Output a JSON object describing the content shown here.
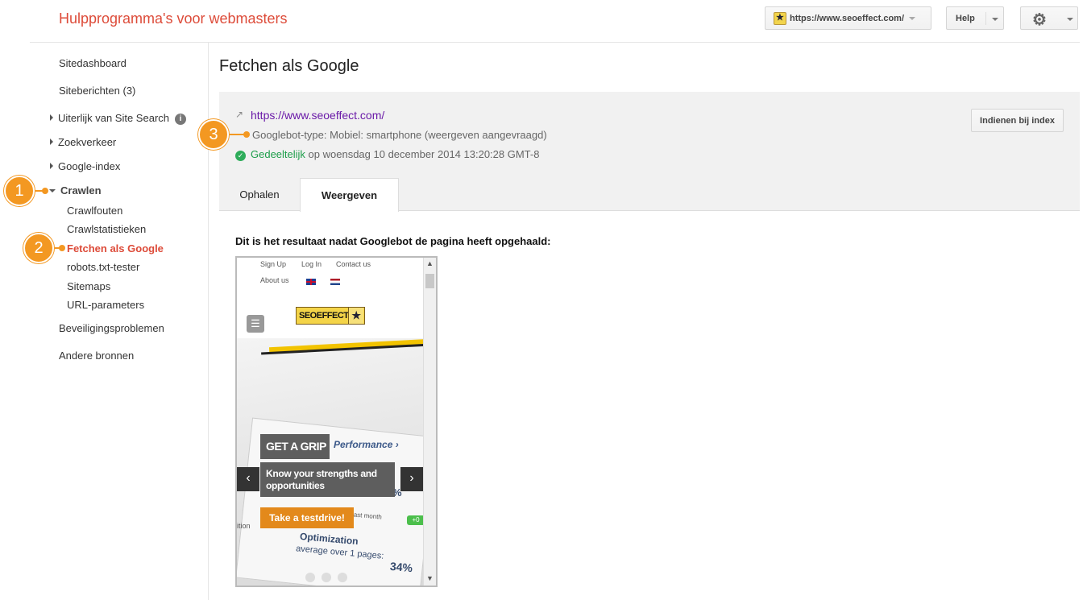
{
  "app_title": "Hulpprogramma's voor webmasters",
  "header": {
    "site_select": "https://www.seoeffect.com/",
    "help_label": "Help"
  },
  "sidebar": {
    "items": [
      {
        "label": "Sitedashboard"
      },
      {
        "label": "Siteberichten (3)"
      },
      {
        "label": "Uiterlijk van Site Search"
      },
      {
        "label": "Zoekverkeer"
      },
      {
        "label": "Google-index"
      },
      {
        "label": "Crawlen"
      },
      {
        "label": "Beveiligingsproblemen"
      },
      {
        "label": "Andere bronnen"
      }
    ],
    "crawl_subitems": [
      {
        "label": "Crawlfouten"
      },
      {
        "label": "Crawlstatistieken"
      },
      {
        "label": "Fetchen als Google"
      },
      {
        "label": "robots.txt-tester"
      },
      {
        "label": "Sitemaps"
      },
      {
        "label": "URL-parameters"
      }
    ],
    "info_glyph": "i"
  },
  "callouts": [
    "1",
    "2",
    "3"
  ],
  "main": {
    "heading": "Fetchen als Google",
    "result": {
      "url": "https://www.seoeffect.com/",
      "bot_type": "Googlebot-type: Mobiel: smartphone (weergeven aangevraagd)",
      "status_label": "Gedeeltelijk",
      "status_detail": " op woensdag 10 december 2014 13:20:28 GMT-8",
      "submit_button": "Indienen bij index"
    },
    "tabs": [
      {
        "label": "Ophalen",
        "active": false
      },
      {
        "label": "Weergeven",
        "active": true
      }
    ],
    "result_heading": "Dit is het resultaat nadat Googlebot de pagina heeft opgehaald:"
  },
  "preview": {
    "top_links": [
      "Sign Up",
      "Log In",
      "Contact us"
    ],
    "about_link": "About us",
    "logo_text": "SEOEFFECT",
    "performance_text": "Performance ›",
    "grip_heading": "GET A GRIP",
    "grip_sub": "Know your strengths and opportunities",
    "cta": "Take a testdrive!",
    "optimization_text": "Optimization",
    "avg_text": "average over 1 pages:",
    "avg_pct": "34%",
    "pct2": "%",
    "last_month": "last month",
    "ition": "ition",
    "badge": "+0"
  },
  "colors": {
    "accent_red": "#dd4b39",
    "callout_orange": "#f39822",
    "status_green": "#1e9e4b",
    "link_purple": "#6a1aa8"
  },
  "icons": {
    "settings": "gear-icon",
    "external_link": "external-link-icon",
    "status": "check-circle-icon",
    "info": "info-icon"
  }
}
